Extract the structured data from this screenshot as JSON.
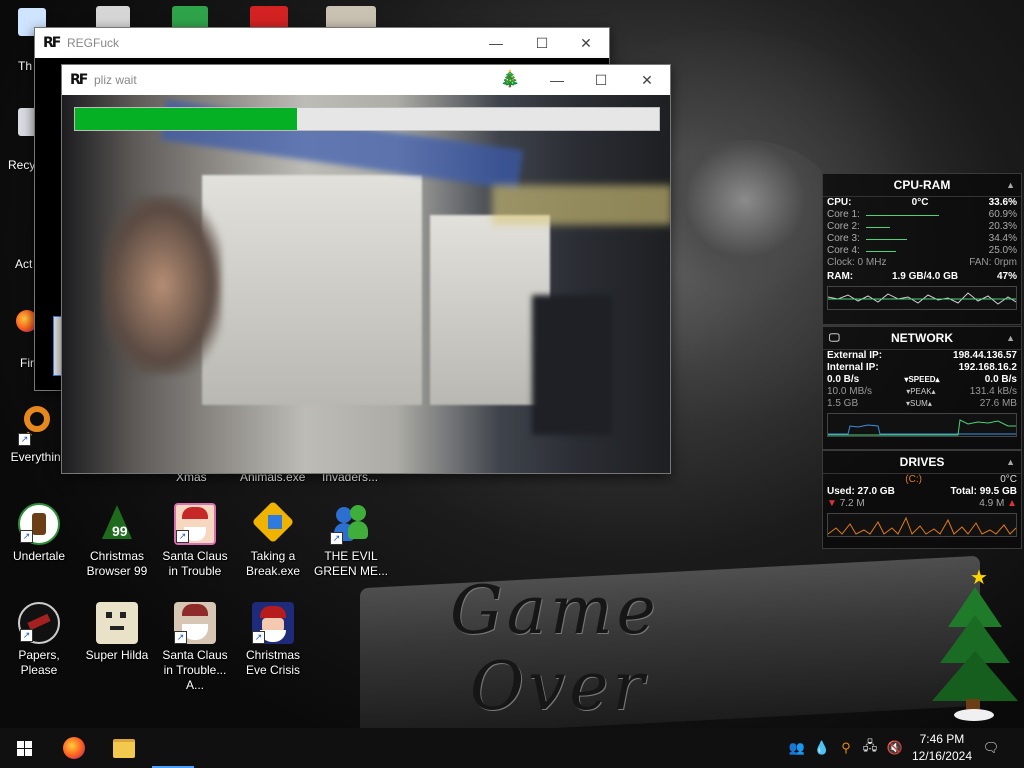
{
  "desktop": {
    "partial_labels": [
      "Th",
      "Recy",
      "Act",
      "Fir"
    ],
    "icons": [
      {
        "label": "Everything",
        "color": "#e8891e"
      },
      {
        "label": "Undertale",
        "color": "#2f8f3a"
      },
      {
        "label": "Papers, Please",
        "color": "#7a1a1a"
      },
      {
        "label": "Xmas",
        "color": ""
      },
      {
        "label": "Animals.exe",
        "color": ""
      },
      {
        "label": "Invaders...",
        "color": ""
      },
      {
        "label": "Christmas Browser 99",
        "color": "#1e6b1e"
      },
      {
        "label": "Santa Claus in Trouble",
        "color": "#c62828"
      },
      {
        "label": "Taking a Break.exe",
        "color": "#f0b400"
      },
      {
        "label": "THE EVIL GREEN ME...",
        "color": "#2c6fd1"
      },
      {
        "label": "Super Hilda",
        "color": "#e9e2c8"
      },
      {
        "label": "Santa Claus in Trouble... A...",
        "color": "#8e2a2a"
      },
      {
        "label": "Christmas Eve Crisis",
        "color": "#b71c1c"
      }
    ],
    "wallpaper_text": [
      "Game",
      "Over"
    ]
  },
  "window_back": {
    "app_logo": "RF",
    "title": "REGFuck",
    "buttons": {
      "minimize": "—",
      "maximize": "☐",
      "close": "✕"
    }
  },
  "window_front": {
    "app_logo": "RF",
    "title": "pliz wait",
    "tree_glyph": "🎄",
    "progress": 0.38,
    "progress_color": "#06b025",
    "buttons": {
      "minimize": "—",
      "maximize": "☐",
      "close": "✕"
    }
  },
  "cpu_ram": {
    "title": "CPU-RAM",
    "cpu_label": "CPU:",
    "cpu_temp": "0°C",
    "cpu_value": "33.6%",
    "cores": [
      {
        "label": "Core 1:",
        "value": "60.9%",
        "level": 0.609
      },
      {
        "label": "Core 2:",
        "value": "20.3%",
        "level": 0.203
      },
      {
        "label": "Core 3:",
        "value": "34.4%",
        "level": 0.344
      },
      {
        "label": "Core 4:",
        "value": "25.0%",
        "level": 0.25
      }
    ],
    "clock": "Clock: 0 MHz",
    "fan": "FAN: 0rpm",
    "ram_label": "RAM:",
    "ram_used": "1.9 GB/4.0 GB",
    "ram_value": "47%"
  },
  "network": {
    "title": "NETWORK",
    "external_label": "External IP:",
    "external_ip": "198.44.136.57",
    "internal_label": "Internal IP:",
    "internal_ip": "192.168.16.2",
    "speed": {
      "left": "0.0 B/s",
      "mid": "▾SPEED▴",
      "right": "0.0 B/s"
    },
    "peak": {
      "left": "10.0 MB/s",
      "mid": "▾PEAK▴",
      "right": "131.4 kB/s"
    },
    "sum": {
      "left": "1.5 GB",
      "mid": "▾SUM▴",
      "right": "27.6 MB"
    }
  },
  "drives": {
    "title": "DRIVES",
    "drive": "(C:)",
    "temp": "0°C",
    "used": "Used: 27.0 GB",
    "total": "Total: 99.5 GB",
    "read": "7.2 M",
    "write": "4.9 M"
  },
  "taskbar": {
    "time": "7:46 PM",
    "date": "12/16/2024"
  }
}
